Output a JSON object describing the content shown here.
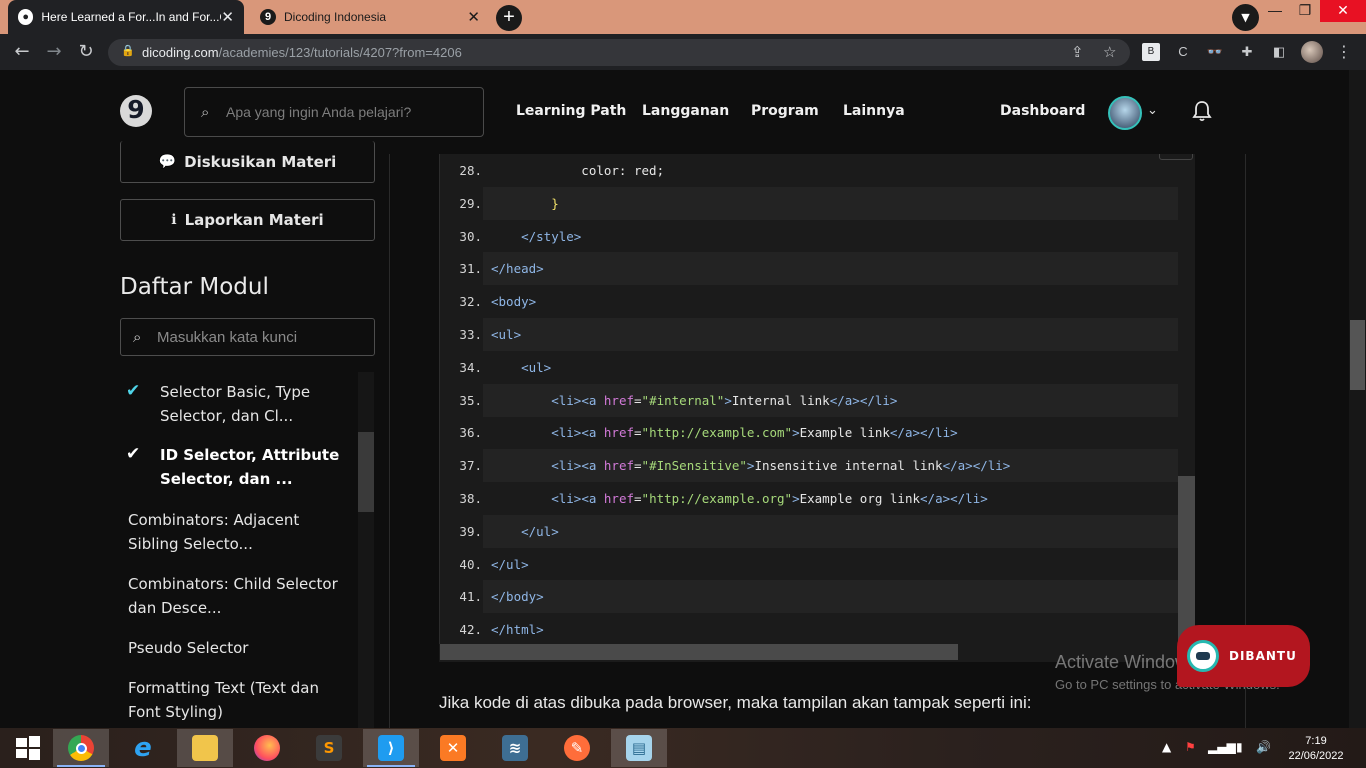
{
  "browser": {
    "tabs": [
      {
        "title": "Here Learned a For...In and For...O",
        "active": true,
        "favicon": "chrome-globe-icon"
      },
      {
        "title": "Dicoding Indonesia",
        "active": false,
        "favicon": "dicoding-logo-icon"
      }
    ],
    "new_tab": "+",
    "url_host": "dicoding.com",
    "url_path": "/academies/123/tutorials/4207?from=4206",
    "ext_labels": {
      "b": "B",
      "c": "C"
    }
  },
  "site": {
    "logo": "9",
    "search_placeholder": "Apa yang ingin Anda pelajari?",
    "nav": [
      "Learning Path",
      "Langganan",
      "Program",
      "Lainnya"
    ],
    "dashboard": "Dashboard"
  },
  "sidebar": {
    "discuss_label": "Diskusikan Materi",
    "report_label": "Laporkan Materi",
    "module_title": "Daftar Modul",
    "module_search_placeholder": "Masukkan kata kunci",
    "modules": [
      {
        "label": "Selector Basic, Type Selector, dan Cl...",
        "done": true,
        "current": false
      },
      {
        "label": "ID Selector, Attribute Selector, dan ...",
        "done": true,
        "current": true
      },
      {
        "label": "Combinators: Adjacent Sibling Selecto...",
        "done": false,
        "current": false
      },
      {
        "label": "Combinators: Child Selector dan Desce...",
        "done": false,
        "current": false
      },
      {
        "label": "Pseudo Selector",
        "done": false,
        "current": false
      },
      {
        "label": "Formatting Text (Text dan Font Styling)",
        "done": false,
        "current": false
      }
    ]
  },
  "code": {
    "lines": [
      {
        "n": "28.",
        "tokens": [
          [
            "t",
            "            color: red;"
          ]
        ]
      },
      {
        "n": "29.",
        "tokens": [
          [
            "t",
            "        "
          ],
          [
            "br",
            "}"
          ]
        ]
      },
      {
        "n": "30.",
        "tokens": [
          [
            "t",
            "    "
          ],
          [
            "tag",
            "</style>"
          ]
        ]
      },
      {
        "n": "31.",
        "tokens": [
          [
            "tag",
            "</head>"
          ]
        ]
      },
      {
        "n": "32.",
        "tokens": [
          [
            "tag",
            "<body>"
          ]
        ]
      },
      {
        "n": "33.",
        "tokens": [
          [
            "tag",
            "<ul>"
          ]
        ]
      },
      {
        "n": "34.",
        "tokens": [
          [
            "t",
            "    "
          ],
          [
            "tag",
            "<ul>"
          ]
        ]
      },
      {
        "n": "35.",
        "tokens": [
          [
            "t",
            "        "
          ],
          [
            "tag",
            "<li><a "
          ],
          [
            "attr",
            "href"
          ],
          [
            "t",
            "="
          ],
          [
            "str",
            "\"#internal\""
          ],
          [
            "tag",
            ">"
          ],
          [
            "t",
            "Internal link"
          ],
          [
            "tag",
            "</a></li>"
          ]
        ]
      },
      {
        "n": "36.",
        "tokens": [
          [
            "t",
            "        "
          ],
          [
            "tag",
            "<li><a "
          ],
          [
            "attr",
            "href"
          ],
          [
            "t",
            "="
          ],
          [
            "str",
            "\"http://example.com\""
          ],
          [
            "tag",
            ">"
          ],
          [
            "t",
            "Example link"
          ],
          [
            "tag",
            "</a></li>"
          ]
        ]
      },
      {
        "n": "37.",
        "tokens": [
          [
            "t",
            "        "
          ],
          [
            "tag",
            "<li><a "
          ],
          [
            "attr",
            "href"
          ],
          [
            "t",
            "="
          ],
          [
            "str",
            "\"#InSensitive\""
          ],
          [
            "tag",
            ">"
          ],
          [
            "t",
            "Insensitive internal link"
          ],
          [
            "tag",
            "</a></li>"
          ]
        ]
      },
      {
        "n": "38.",
        "tokens": [
          [
            "t",
            "        "
          ],
          [
            "tag",
            "<li><a "
          ],
          [
            "attr",
            "href"
          ],
          [
            "t",
            "="
          ],
          [
            "str",
            "\"http://example.org\""
          ],
          [
            "tag",
            ">"
          ],
          [
            "t",
            "Example org link"
          ],
          [
            "tag",
            "</a></li>"
          ]
        ]
      },
      {
        "n": "39.",
        "tokens": [
          [
            "t",
            "    "
          ],
          [
            "tag",
            "</ul>"
          ]
        ]
      },
      {
        "n": "40.",
        "tokens": [
          [
            "tag",
            "</ul>"
          ]
        ]
      },
      {
        "n": "41.",
        "tokens": [
          [
            "tag",
            "</body>"
          ]
        ]
      },
      {
        "n": "42.",
        "tokens": [
          [
            "tag",
            "</html>"
          ]
        ]
      }
    ]
  },
  "content": {
    "caption": "Jika kode di atas dibuka pada browser, maka tampilan akan tampak seperti ini:"
  },
  "overlay": {
    "activate_title": "Activate Windows",
    "activate_sub": "Go to PC settings to activate Windows.",
    "chat_label": "DIBANTU"
  },
  "taskbar": {
    "apps": [
      "windows-start",
      "chrome",
      "internet-explorer",
      "file-explorer",
      "firefox",
      "sublime-text",
      "vs-code",
      "xampp",
      "mysql-workbench",
      "paint-brush",
      "notepad"
    ],
    "time": "7:19",
    "date": "22/06/2022"
  },
  "colors": {
    "accent": "#35c1ba",
    "chat": "#b3161f",
    "tab_strip": "#d9977a"
  }
}
